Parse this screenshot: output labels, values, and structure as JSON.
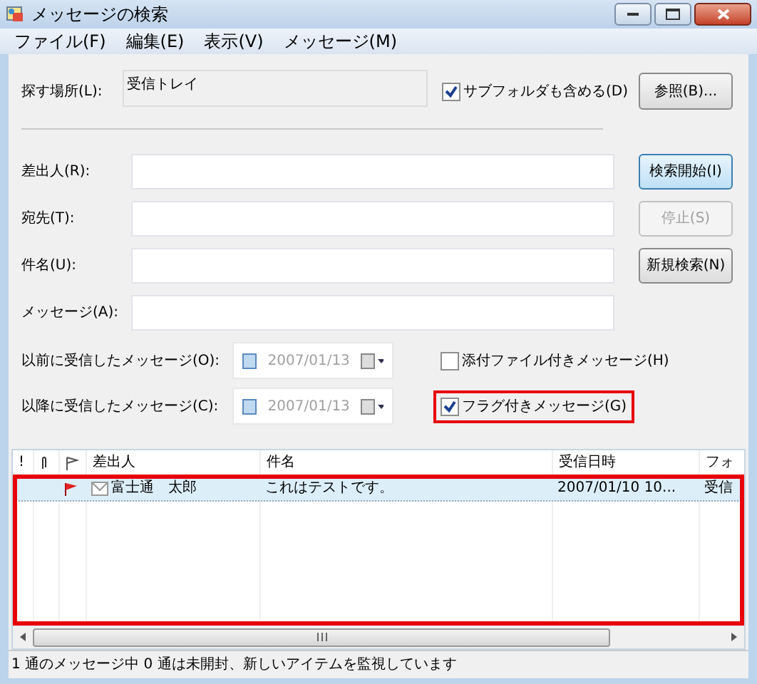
{
  "window": {
    "title": "メッセージの検索"
  },
  "menu": [
    "ファイル(F)",
    "編集(E)",
    "表示(V)",
    "メッセージ(M)"
  ],
  "location": {
    "label": "探す場所(L):",
    "value": "受信トレイ"
  },
  "include_subfolders": {
    "label": "サブフォルダも含める(D)",
    "checked": true
  },
  "browse_button": {
    "label": "参照(B)..."
  },
  "fields": [
    {
      "label": "差出人(R):"
    },
    {
      "label": "宛先(T):"
    },
    {
      "label": "件名(U):"
    },
    {
      "label": "メッセージ(A):"
    }
  ],
  "action_buttons": [
    {
      "label": "検索開始(I)",
      "disabled": false,
      "default": true
    },
    {
      "label": "停止(S)",
      "disabled": true,
      "default": false
    },
    {
      "label": "新規検索(N)",
      "disabled": false,
      "default": false
    }
  ],
  "date_filters": [
    {
      "label": "以前に受信したメッセージ(O):",
      "value": "2007/01/13",
      "checked": false
    },
    {
      "label": "以降に受信したメッセージ(C):",
      "value": "2007/01/13",
      "checked": false
    }
  ],
  "options": [
    {
      "label": "添付ファイル付きメッセージ(H)",
      "checked": false,
      "highlighted": false
    },
    {
      "label": "フラグ付きメッセージ(G)",
      "checked": true,
      "highlighted": true
    }
  ],
  "results": {
    "highlighted": true,
    "columns": [
      {
        "kind": "text",
        "label": "!"
      },
      {
        "kind": "attachment"
      },
      {
        "kind": "flag"
      },
      {
        "kind": "text",
        "label": "差出人"
      },
      {
        "kind": "text",
        "label": "件名"
      },
      {
        "kind": "text",
        "label": "受信日時"
      },
      {
        "kind": "text",
        "label": "フォ"
      }
    ],
    "rows": [
      {
        "selected": true,
        "flagged": true,
        "from": "富士通　太郎",
        "subject": "これはテストです。",
        "received": "2007/01/10 10...",
        "folder": "受信"
      }
    ]
  },
  "status_bar": "1 通のメッセージ中 0 通は未開封、新しいアイテムを監視しています"
}
